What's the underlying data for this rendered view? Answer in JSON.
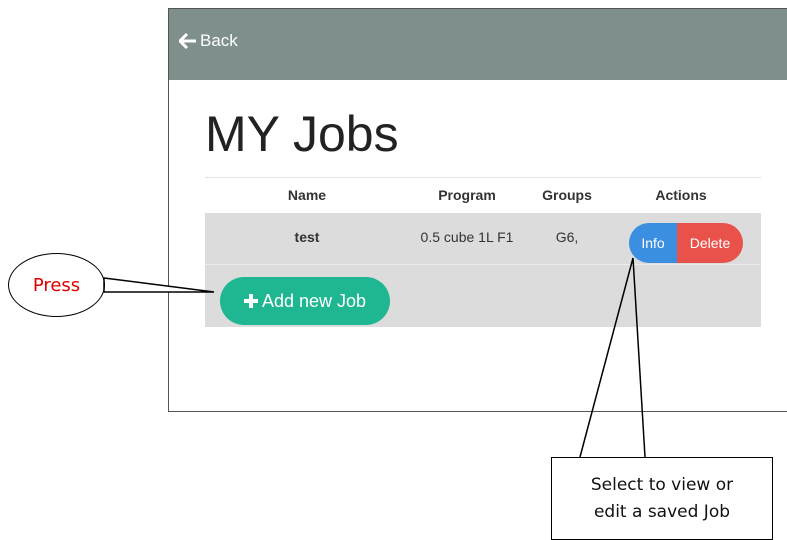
{
  "header": {
    "back_label": "Back"
  },
  "page": {
    "title": "MY Jobs"
  },
  "table": {
    "columns": [
      "Name",
      "Program",
      "Groups",
      "Actions"
    ],
    "rows": [
      {
        "name": "test",
        "program": "0.5 cube 1L F1",
        "groups": "G6,"
      }
    ],
    "actions": {
      "info_label": "Info",
      "delete_label": "Delete"
    }
  },
  "add_button": {
    "label": "Add new Job"
  },
  "annotations": {
    "press": "Press",
    "select_line1": "Select to view or",
    "select_line2": "edit a saved Job"
  },
  "colors": {
    "topbar": "#7f8f8c",
    "info": "#3b8fe0",
    "delete": "#e8524a",
    "add": "#1fb791",
    "press_text": "#e00000"
  },
  "icons": {
    "back": "arrow-left-icon",
    "add": "plus-icon"
  }
}
